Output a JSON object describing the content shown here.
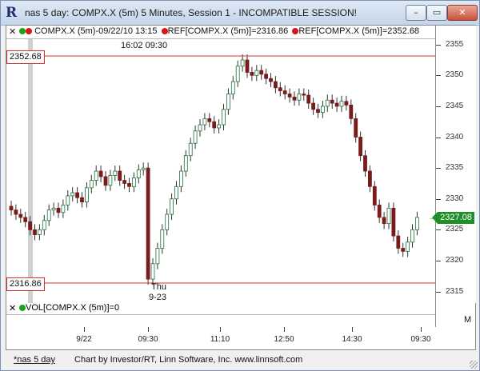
{
  "window": {
    "title": "nas 5 day: COMPX.X (5m) 5 Minutes, Session 1 - INCOMPATIBLE SESSION!",
    "app_icon": "R",
    "minimize": "–",
    "maximize": "▭",
    "close": "✕"
  },
  "legend": {
    "close": "✕",
    "items": [
      "COMPX.X (5m)-09/22/10 13:15",
      "REF[COMPX.X (5m)]=2316.86",
      "REF[COMPX.X (5m)]=2352.68"
    ]
  },
  "ref_lines": {
    "upper": "2352.68",
    "lower": "2316.86",
    "color": "#d93030"
  },
  "last_price": "2327.08",
  "notes": {
    "top_time": "16:02  09:30",
    "thu": "Thu",
    "date": "9-23"
  },
  "volume": {
    "close": "✕",
    "label": "VOL[COMPX.X (5m)]=0",
    "m_button": "M"
  },
  "status": {
    "tab": "*nas 5 day",
    "credit": "Chart by Investor/RT, Linn Software, Inc. www.linnsoft.com"
  },
  "colors": {
    "up": "#2e8b57",
    "down": "#7a1b1b",
    "ref": "#d93030",
    "last": "#1f8f2a"
  },
  "chart_data": {
    "type": "candlestick",
    "symbol": "COMPX.X (5m)",
    "y_ticks": [
      2315,
      2320,
      2325,
      2330,
      2335,
      2340,
      2345,
      2350,
      2355
    ],
    "ylim": [
      2313,
      2356
    ],
    "x_tick_labels": [
      "9/22",
      "09:30",
      "11:10",
      "12:50",
      "14:30",
      "09:30"
    ],
    "closes": [
      2328.2,
      2327.5,
      2327.0,
      2326.3,
      2325.0,
      2324.2,
      2325.0,
      2326.5,
      2328.2,
      2328.5,
      2327.8,
      2329.0,
      2330.5,
      2331.0,
      2330.2,
      2329.5,
      2331.8,
      2333.0,
      2334.5,
      2333.6,
      2332.2,
      2333.8,
      2334.5,
      2333.0,
      2332.5,
      2332.0,
      2333.4,
      2334.7,
      2335.0,
      2317.0,
      2319.5,
      2322.0,
      2325.0,
      2327.5,
      2330.0,
      2332.0,
      2334.5,
      2337.0,
      2339.0,
      2341.0,
      2342.0,
      2343.0,
      2342.5,
      2341.5,
      2342.0,
      2344.5,
      2347.0,
      2349.0,
      2351.5,
      2352.5,
      2350.5,
      2350.0,
      2350.8,
      2350.2,
      2349.5,
      2349.0,
      2348.0,
      2347.5,
      2347.0,
      2346.5,
      2346.0,
      2347.0,
      2346.8,
      2345.5,
      2344.5,
      2344.0,
      2345.0,
      2346.0,
      2345.5,
      2345.0,
      2345.8,
      2345.2,
      2343.0,
      2340.0,
      2337.0,
      2334.5,
      2332.0,
      2329.0,
      2327.0,
      2326.0,
      2328.5,
      2324.0,
      2322.0,
      2321.5,
      2323.0,
      2325.0,
      2327.0
    ]
  }
}
